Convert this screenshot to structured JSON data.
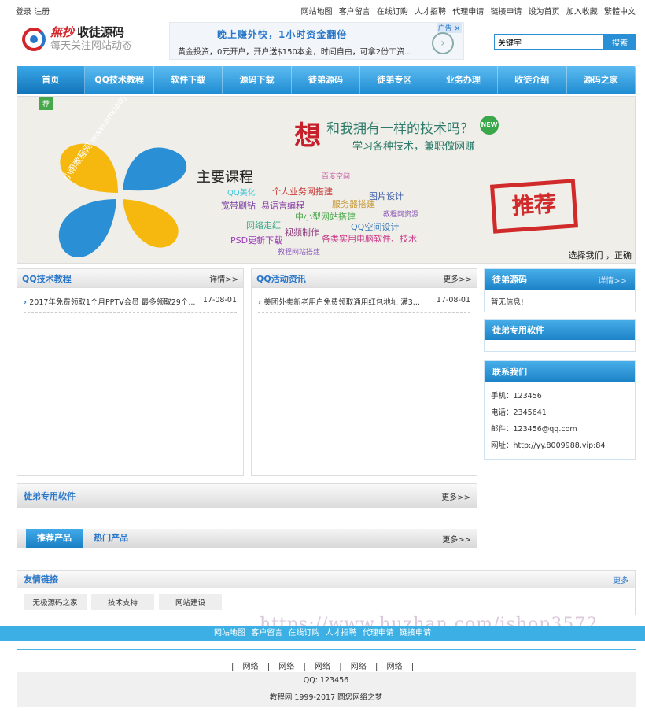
{
  "topbar": {
    "left": [
      "登录",
      "注册"
    ],
    "right": [
      "网站地图",
      "客户留言",
      "在线订购",
      "人才招聘",
      "代理申请",
      "链接申请",
      "设为首页",
      "加入收藏",
      "繁體中文"
    ]
  },
  "logo": {
    "brand": "無抄",
    "name": "收徒源码",
    "slogan": "每天关注网站动态"
  },
  "ad": {
    "line1": "晚上赚外快，1小时资金翻倍",
    "line2": "黄金投资，0元开户，开户送$150本金，时间自由，可拿2份工资...",
    "tag": "广告",
    "close": "✕"
  },
  "search": {
    "value": "关键字",
    "button": "搜索"
  },
  "nav": [
    "首页",
    "QQ技术教程",
    "软件下载",
    "源码下载",
    "徒弟源码",
    "徒弟专区",
    "业务办理",
    "收徒介绍",
    "源码之家"
  ],
  "banner": {
    "tag": "荐",
    "big": "想",
    "question": "和我拥有一样的技术吗？",
    "subline": "学习各种技术，兼职做网赚",
    "new_badge": "NEW",
    "course_title": "主要课程",
    "vertical_text": "小雨教程网 www.anxiaoyu.me",
    "keywords": [
      "QQ美化",
      "个人业务网搭建",
      "图片设计",
      "宽带刷钻",
      "易语言编程",
      "服务器搭建",
      "中小型网站搭建",
      "网络走红",
      "QQ空间设计",
      "视频制作",
      "PSD更新下载",
      "各类实用电脑软件、技术",
      "教程网站搭建",
      "教程网资源",
      "百度空间"
    ],
    "stamp": "推荐",
    "caption": "选择我们 ，正确"
  },
  "qq_tutorial": {
    "title": "QQ技术教程",
    "more": "详情>>",
    "items": [
      {
        "text": "2017年免费领取1个月PPTV会员 最多领取29个...",
        "date": "17-08-01"
      }
    ]
  },
  "qq_news": {
    "title": "QQ活动资讯",
    "more": "更多>>",
    "items": [
      {
        "text": "美团外卖新老用户免费领取通用红包地址 满3...",
        "date": "17-08-01"
      }
    ]
  },
  "side": {
    "source": {
      "title": "徒弟源码",
      "more": "详情>>",
      "empty": "暂无信息!"
    },
    "software": {
      "title": "徒弟专用软件"
    },
    "contact": {
      "title": "联系我们",
      "lines": [
        "手机：123456",
        "电话：2345641",
        "邮件：123456@qq.com",
        "网址：http://yy.8009988.vip:84"
      ]
    }
  },
  "software_bar": {
    "title": "徒弟专用软件",
    "more": "更多>>"
  },
  "product_tabs": {
    "tabs": [
      "推荐产品",
      "热门产品"
    ],
    "more": "更多>>"
  },
  "friend_links": {
    "title": "友情链接",
    "more": "更多",
    "items": [
      "无极源码之家",
      "技术支持",
      "网站建设"
    ]
  },
  "footer": {
    "nav": [
      "网站地图",
      "客户留言",
      "在线订购",
      "人才招聘",
      "代理申请",
      "链接申请"
    ],
    "links": [
      "|",
      "网络",
      "|",
      "网络",
      "|",
      "网络",
      "|",
      "网络",
      "|",
      "网络",
      "|"
    ],
    "qq": "QQ: 123456",
    "copyright": "教程网 1999-2017 圆您网络之梦"
  },
  "watermark": "https://www.huzhan.com/ishop3572",
  "colors": {
    "accent": "#2a77c9",
    "nav": "#1e8bd2",
    "stamp": "#d12a2a"
  }
}
